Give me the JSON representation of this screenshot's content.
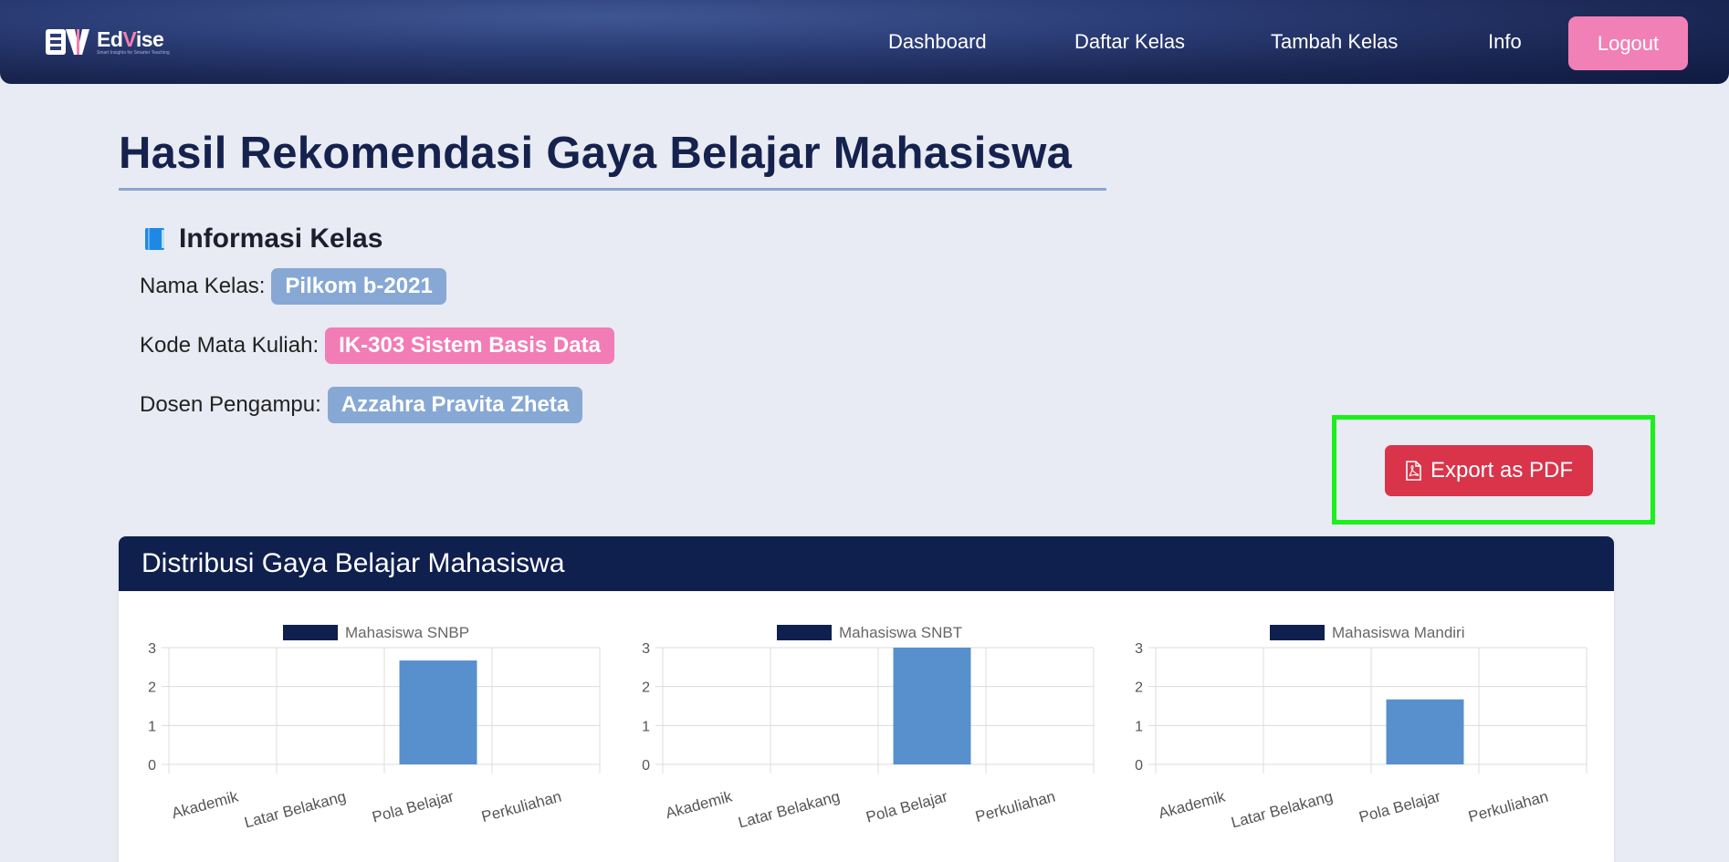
{
  "brand": {
    "name_prefix": "Ed",
    "name_accent": "V",
    "name_suffix": "ise",
    "tagline": "Smart Insights for Smarter Teaching"
  },
  "nav": {
    "links": [
      "Dashboard",
      "Daftar Kelas",
      "Tambah Kelas",
      "Info"
    ],
    "logout": "Logout"
  },
  "page": {
    "title": "Hasil Rekomendasi Gaya Belajar Mahasiswa"
  },
  "info": {
    "heading_icon": "book-icon",
    "heading": "Informasi Kelas",
    "nama_kelas_label": "Nama Kelas:",
    "nama_kelas_value": "Pilkom b-2021",
    "kode_label": "Kode Mata Kuliah:",
    "kode_value": "IK-303 Sistem Basis Data",
    "dosen_label": "Dosen Pengampu:",
    "dosen_value": "Azzahra Pravita Zheta"
  },
  "export": {
    "label": "Export as PDF",
    "icon": "pdf-icon"
  },
  "card": {
    "title": "Distribusi Gaya Belajar Mahasiswa"
  },
  "colors": {
    "navy": "#0f1f4e",
    "bar": "#5790cc",
    "pink": "#f180b6",
    "danger": "#d9344a",
    "highlight": "#1af019"
  },
  "chart_data": [
    {
      "type": "bar",
      "categories": [
        "Akademik",
        "Latar Belakang",
        "Pola Belajar",
        "Perkuliahan"
      ],
      "series": [
        {
          "name": "Mahasiswa SNBP",
          "values": [
            0,
            0,
            2.67,
            0
          ]
        }
      ],
      "ylim": [
        0,
        3
      ],
      "yticks": [
        "0",
        "1",
        "2",
        "3"
      ],
      "legend": "top",
      "grid": true
    },
    {
      "type": "bar",
      "categories": [
        "Akademik",
        "Latar Belakang",
        "Pola Belajar",
        "Perkuliahan"
      ],
      "series": [
        {
          "name": "Mahasiswa SNBT",
          "values": [
            0,
            0,
            3,
            0
          ]
        }
      ],
      "ylim": [
        0,
        3
      ],
      "yticks": [
        "0",
        "1",
        "2",
        "3"
      ],
      "legend": "top",
      "grid": true
    },
    {
      "type": "bar",
      "categories": [
        "Akademik",
        "Latar Belakang",
        "Pola Belajar",
        "Perkuliahan"
      ],
      "series": [
        {
          "name": "Mahasiswa Mandiri",
          "values": [
            0,
            0,
            1.67,
            0
          ]
        }
      ],
      "ylim": [
        0,
        3
      ],
      "yticks": [
        "0",
        "1",
        "2",
        "3"
      ],
      "legend": "top",
      "grid": true
    }
  ]
}
